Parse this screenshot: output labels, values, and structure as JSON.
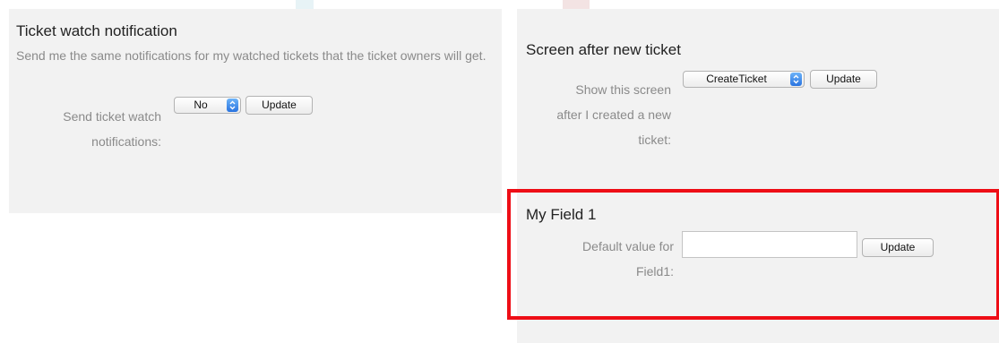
{
  "colors": {
    "panel_background": "#f2f2f2",
    "highlight_border": "#ee0e16",
    "select_arrow": "#2a74e0",
    "muted_text": "#8a8a8a"
  },
  "ticket_watch": {
    "title": "Ticket watch notification",
    "description": "Send me the same notifications for my watched tickets that the ticket owners will get.",
    "label_lines": [
      "Send ticket watch",
      "notifications:"
    ],
    "select": {
      "value": "No",
      "icon": "chevron-updown-icon"
    },
    "update_label": "Update"
  },
  "screen_after_new_ticket": {
    "title": "Screen after new ticket",
    "label_lines": [
      "Show this screen",
      "after I created a new",
      "ticket:"
    ],
    "select": {
      "value": "CreateTicket",
      "icon": "chevron-updown-icon"
    },
    "update_label": "Update"
  },
  "my_field_1": {
    "title": "My Field 1",
    "label_lines": [
      "Default value for",
      "Field1:"
    ],
    "input": {
      "value": ""
    },
    "update_label": "Update"
  }
}
